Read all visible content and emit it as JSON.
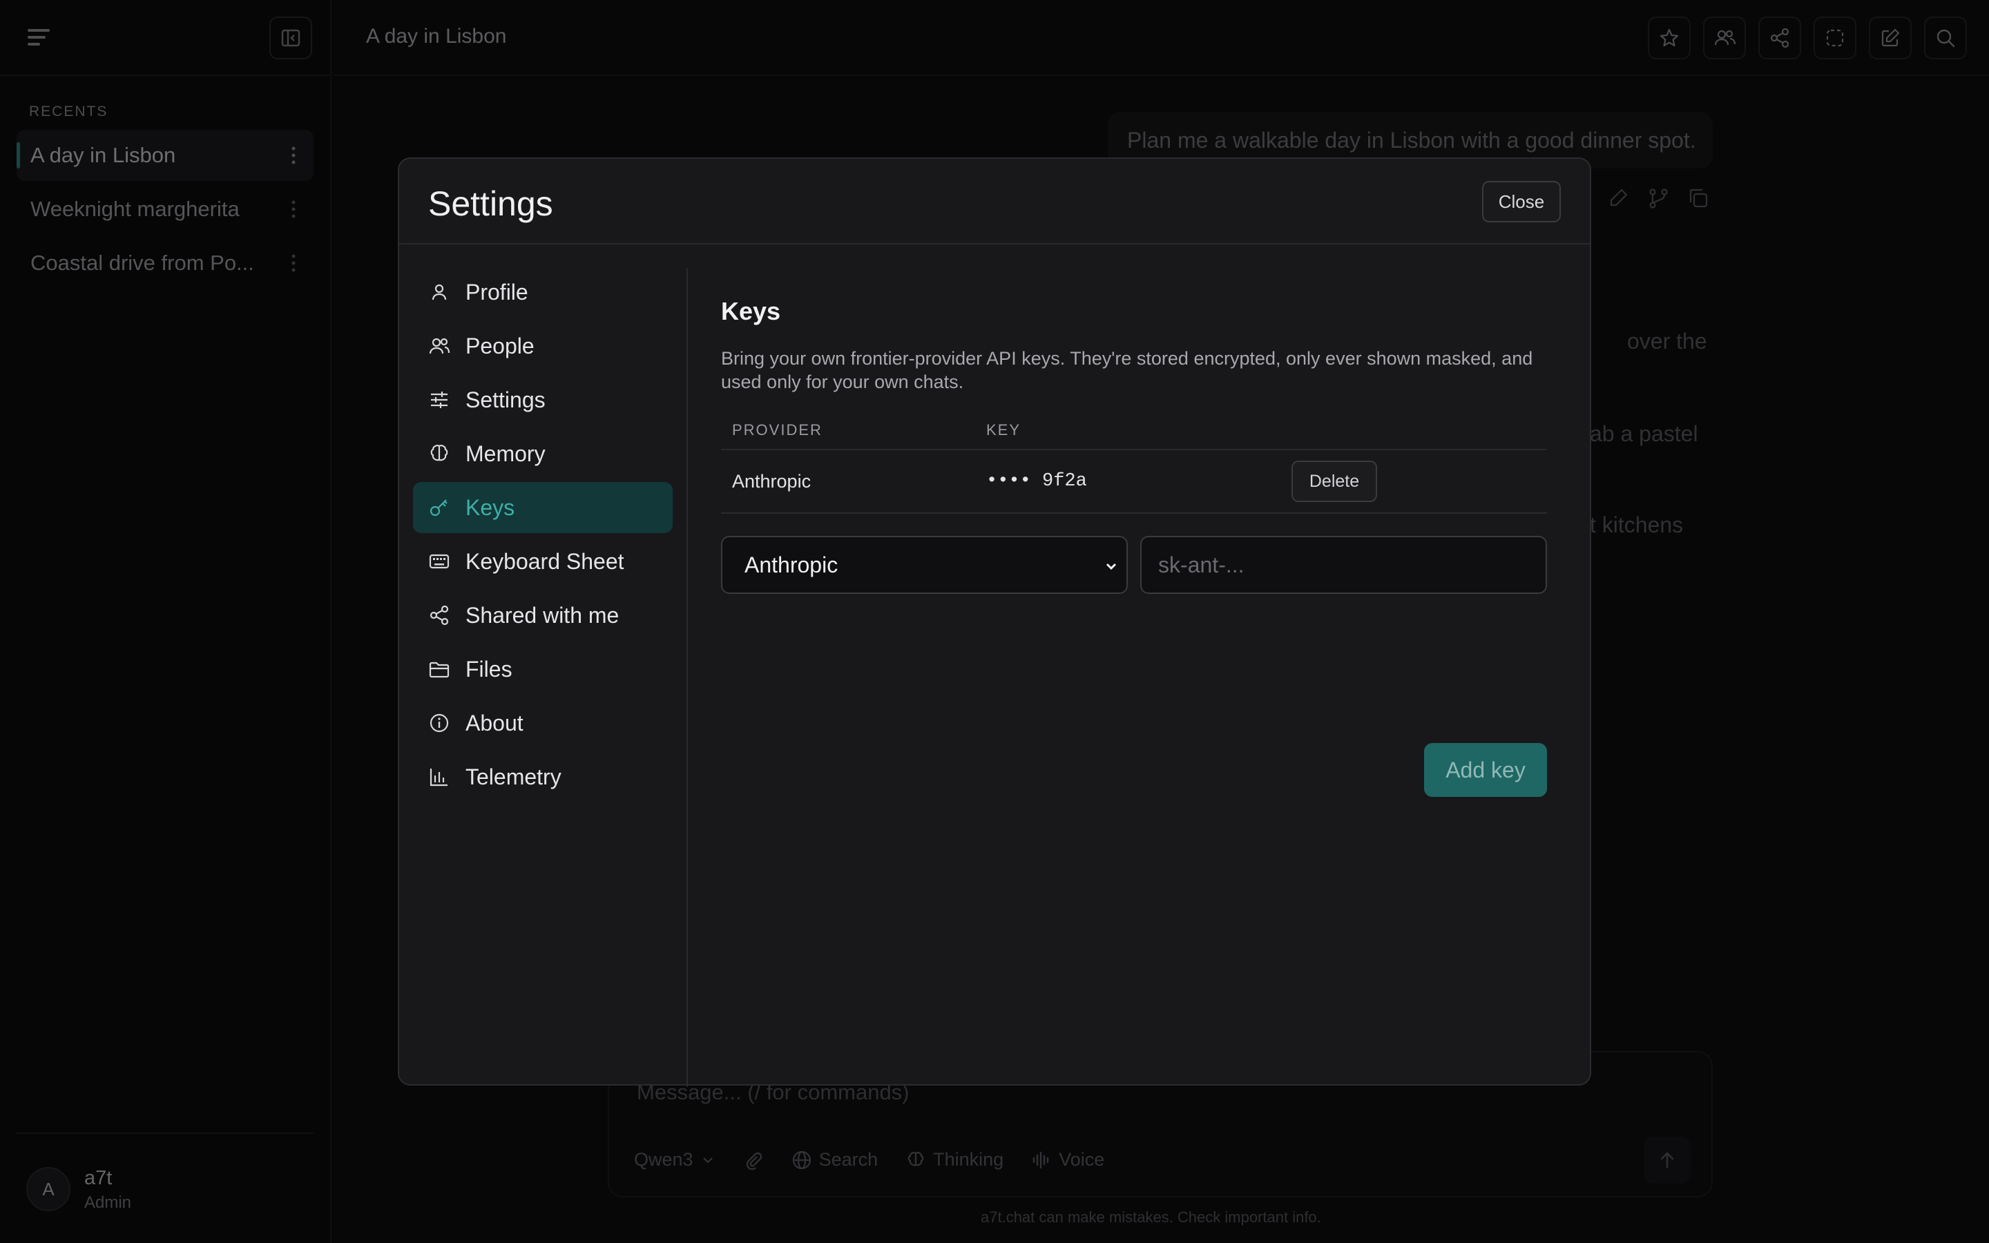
{
  "sidebar": {
    "recents_label": "RECENTS",
    "chats": [
      {
        "title": "A day in Lisbon",
        "active": true
      },
      {
        "title": "Weeknight margherita",
        "active": false
      },
      {
        "title": "Coastal drive from Po...",
        "active": false
      }
    ],
    "user": {
      "initial": "A",
      "name": "a7t",
      "role": "Admin"
    }
  },
  "header": {
    "title": "A day in Lisbon",
    "buttons": [
      "star-icon",
      "people-icon",
      "share-icon",
      "select-icon",
      "new-chat-icon",
      "search-icon"
    ]
  },
  "conversation": {
    "user_message": "Plan me a walkable day in Lisbon with a good dinner spot.",
    "visible_fragments": [
      "over the",
      "ab a pastel",
      "t kitchens"
    ]
  },
  "composer": {
    "placeholder": "Message...  (/ for commands)",
    "model": "Qwen3",
    "tools": {
      "search": "Search",
      "thinking": "Thinking",
      "voice": "Voice"
    },
    "disclaimer": "a7t.chat can make mistakes. Check important info."
  },
  "settings_modal": {
    "title": "Settings",
    "close_label": "Close",
    "nav": [
      {
        "label": "Profile",
        "icon": "user-icon"
      },
      {
        "label": "People",
        "icon": "people-icon"
      },
      {
        "label": "Settings",
        "icon": "sliders-icon"
      },
      {
        "label": "Memory",
        "icon": "brain-icon"
      },
      {
        "label": "Keys",
        "icon": "key-icon",
        "active": true
      },
      {
        "label": "Keyboard Sheet",
        "icon": "keyboard-icon"
      },
      {
        "label": "Shared with me",
        "icon": "share-icon"
      },
      {
        "label": "Files",
        "icon": "folder-icon"
      },
      {
        "label": "About",
        "icon": "info-icon"
      },
      {
        "label": "Telemetry",
        "icon": "bar-chart-icon"
      }
    ],
    "keys": {
      "title": "Keys",
      "description": "Bring your own frontier-provider API keys. They're stored encrypted, only ever shown masked, and used only for your own chats.",
      "columns": [
        "PROVIDER",
        "KEY"
      ],
      "rows": [
        {
          "provider": "Anthropic",
          "key": "•••• 9f2a",
          "action": "Delete"
        }
      ],
      "provider_select": "Anthropic",
      "key_placeholder": "sk-ant-...",
      "add_label": "Add key"
    }
  },
  "colors": {
    "accent": "#3fb0a6",
    "accent_bg": "#12383a",
    "add_button": "#1f6764"
  }
}
